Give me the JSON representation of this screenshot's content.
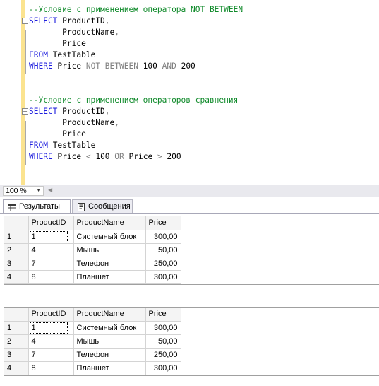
{
  "editor": {
    "lines": [
      [
        {
          "c": "cm",
          "t": "--Условие с применением оператора NOT BETWEEN"
        }
      ],
      [
        {
          "c": "kw",
          "t": "SELECT "
        },
        {
          "c": "id",
          "t": "ProductID"
        },
        {
          "c": "op",
          "t": ","
        }
      ],
      [
        {
          "c": "id",
          "t": "       ProductName"
        },
        {
          "c": "op",
          "t": ","
        }
      ],
      [
        {
          "c": "id",
          "t": "       Price"
        }
      ],
      [
        {
          "c": "kw",
          "t": "FROM "
        },
        {
          "c": "id",
          "t": "TestTable"
        }
      ],
      [
        {
          "c": "kw",
          "t": "WHERE "
        },
        {
          "c": "id",
          "t": "Price "
        },
        {
          "c": "op",
          "t": "NOT BETWEEN "
        },
        {
          "c": "nm",
          "t": "100 "
        },
        {
          "c": "op",
          "t": "AND "
        },
        {
          "c": "nm",
          "t": "200"
        }
      ],
      [],
      [],
      [
        {
          "c": "cm",
          "t": "--Условие с применением операторов сравнения"
        }
      ],
      [
        {
          "c": "kw",
          "t": "SELECT "
        },
        {
          "c": "id",
          "t": "ProductID"
        },
        {
          "c": "op",
          "t": ","
        }
      ],
      [
        {
          "c": "id",
          "t": "       ProductName"
        },
        {
          "c": "op",
          "t": ","
        }
      ],
      [
        {
          "c": "id",
          "t": "       Price"
        }
      ],
      [
        {
          "c": "kw",
          "t": "FROM "
        },
        {
          "c": "id",
          "t": "TestTable"
        }
      ],
      [
        {
          "c": "kw",
          "t": "WHERE "
        },
        {
          "c": "id",
          "t": "Price "
        },
        {
          "c": "op",
          "t": "< "
        },
        {
          "c": "nm",
          "t": "100 "
        },
        {
          "c": "op",
          "t": "OR "
        },
        {
          "c": "id",
          "t": "Price "
        },
        {
          "c": "op",
          "t": "> "
        },
        {
          "c": "nm",
          "t": "200"
        }
      ]
    ],
    "outline_marker": "−"
  },
  "zoom": {
    "value": "100 %",
    "arrow": "▼",
    "scroll_left": "◀"
  },
  "tabs": {
    "results": "Результаты",
    "messages": "Сообщения"
  },
  "grids": [
    {
      "columns": [
        "ProductID",
        "ProductName",
        "Price"
      ],
      "rows": [
        [
          "1",
          "1",
          "Системный блок",
          "300,00"
        ],
        [
          "2",
          "4",
          "Мышь",
          "50,00"
        ],
        [
          "3",
          "7",
          "Телефон",
          "250,00"
        ],
        [
          "4",
          "8",
          "Планшет",
          "300,00"
        ]
      ]
    },
    {
      "columns": [
        "ProductID",
        "ProductName",
        "Price"
      ],
      "rows": [
        [
          "1",
          "1",
          "Системный блок",
          "300,00"
        ],
        [
          "2",
          "4",
          "Мышь",
          "50,00"
        ],
        [
          "3",
          "7",
          "Телефон",
          "250,00"
        ],
        [
          "4",
          "8",
          "Планшет",
          "300,00"
        ]
      ]
    }
  ],
  "colors": {
    "keyword": "#1f1fde",
    "comment": "#0f8a2a",
    "operator": "#808080",
    "change_bar": "#fbe38f"
  }
}
